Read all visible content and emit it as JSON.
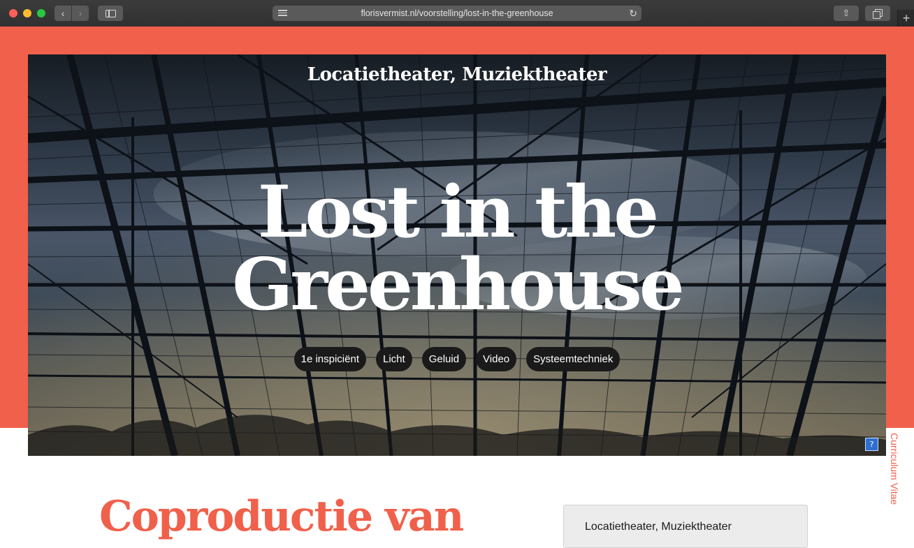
{
  "browser": {
    "url": "florisvermist.nl/voorstelling/lost-in-the-greenhouse",
    "back_glyph": "‹",
    "forward_glyph": "›",
    "reload_glyph": "↻",
    "share_glyph": "⇧",
    "newtab_glyph": "+"
  },
  "hero": {
    "genre": "Locatietheater, Muziektheater",
    "title_line1": "Lost in the",
    "title_line2": "Greenhouse",
    "tags": [
      "1e inspiciënt",
      "Licht",
      "Geluid",
      "Video",
      "Systeemtechniek"
    ],
    "info_glyph": "?"
  },
  "side_nav": {
    "cv_label": "Curriculum Vitae"
  },
  "content": {
    "heading": "Coproductie van",
    "info_box_text": "Locatietheater, Muziektheater"
  },
  "colors": {
    "accent": "#f0604a",
    "tag_bg": "#1a1a1a",
    "chrome_bg": "#3c3b3c"
  }
}
